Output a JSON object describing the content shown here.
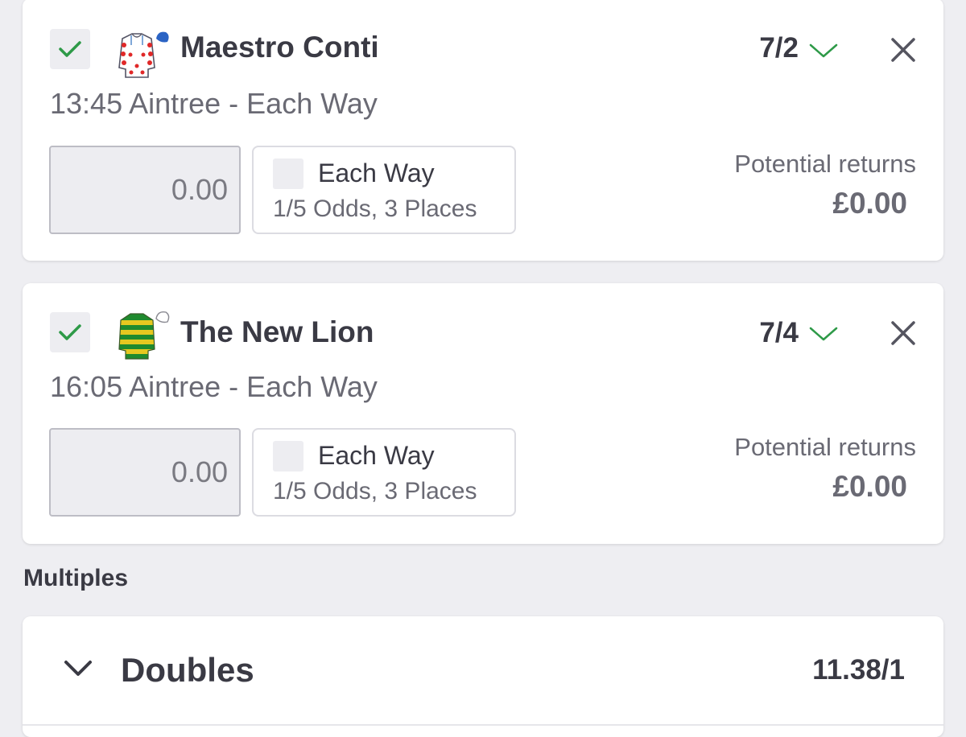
{
  "colors": {
    "accent_green": "#2e9a48",
    "background": "#eeeef2",
    "card": "#ffffff",
    "text_dark": "#3a3a44",
    "text_muted": "#6a6a74"
  },
  "bets": [
    {
      "selected": true,
      "silk_icon": "jockey-silk-white-red-spots-blue-cap",
      "name": "Maestro Conti",
      "odds": "7/2",
      "event": "13:45 Aintree - Each Way",
      "stake_placeholder": "0.00",
      "each_way_checked": false,
      "each_way_label": "Each Way",
      "each_way_terms": "1/5 Odds, 3 Places",
      "returns_label": "Potential returns",
      "returns_value": "£0.00"
    },
    {
      "selected": true,
      "silk_icon": "jockey-silk-green-yellow-hoops-white-cap",
      "name": "The New Lion",
      "odds": "7/4",
      "event": "16:05 Aintree - Each Way",
      "stake_placeholder": "0.00",
      "each_way_checked": false,
      "each_way_label": "Each Way",
      "each_way_terms": "1/5 Odds, 3 Places",
      "returns_label": "Potential returns",
      "returns_value": "£0.00"
    }
  ],
  "multiples": {
    "heading": "Multiples",
    "items": [
      {
        "title": "Doubles",
        "odds": "11.38/1",
        "expand_icon": "chevron-down-icon"
      }
    ]
  }
}
